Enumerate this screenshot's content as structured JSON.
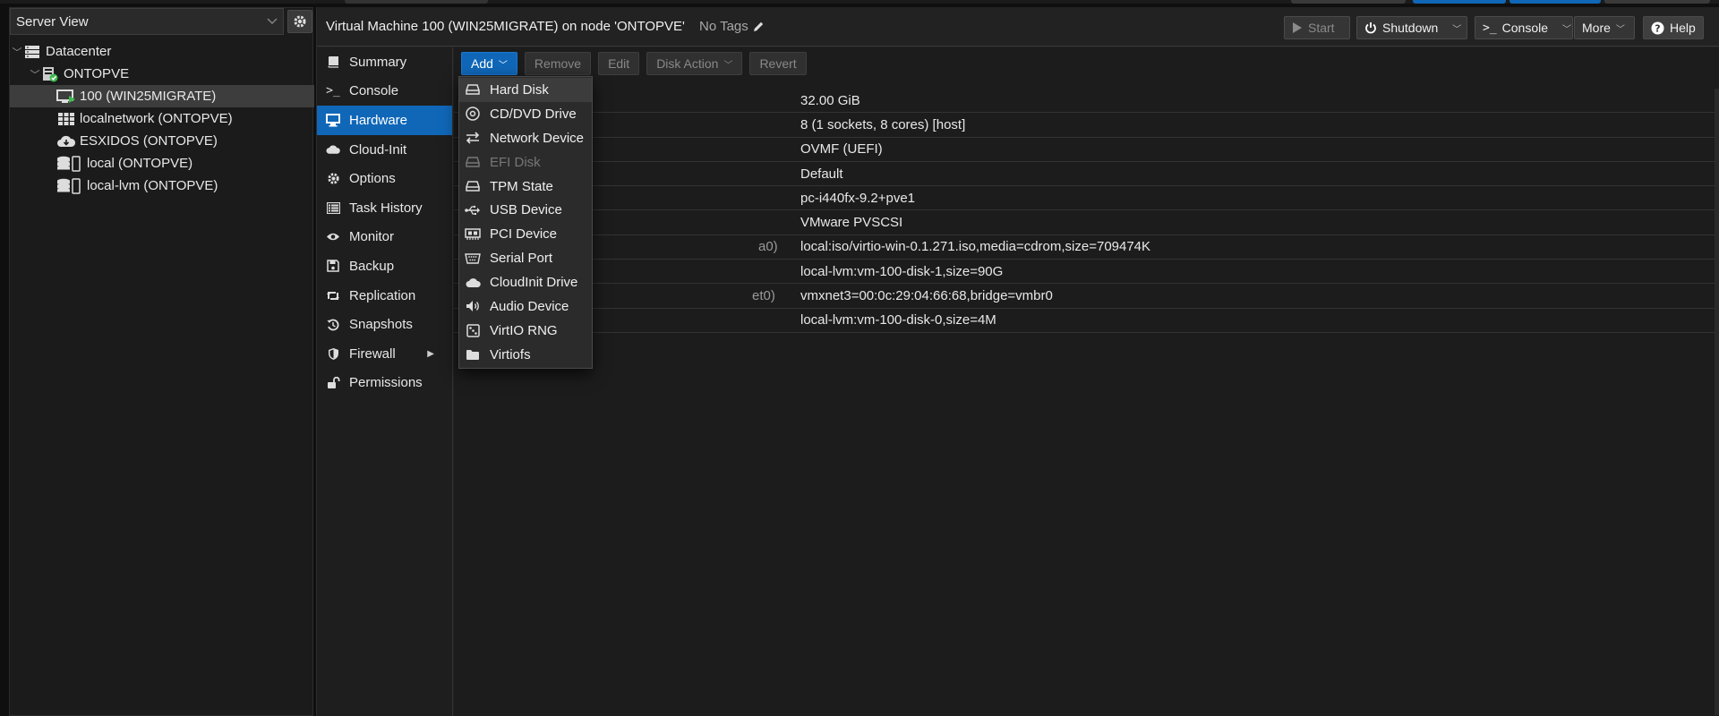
{
  "tree_panel": {
    "view_selector": "Server View",
    "nodes": [
      {
        "label": "Datacenter"
      },
      {
        "label": "ONTOPVE"
      },
      {
        "label": "100 (WIN25MIGRATE)"
      },
      {
        "label": "localnetwork (ONTOPVE)"
      },
      {
        "label": "ESXIDOS (ONTOPVE)"
      },
      {
        "label": "local (ONTOPVE)"
      },
      {
        "label": "local-lvm (ONTOPVE)"
      }
    ]
  },
  "header": {
    "title": "Virtual Machine 100 (WIN25MIGRATE) on node 'ONTOPVE'",
    "tags": "No Tags",
    "buttons": {
      "start": "Start",
      "shutdown": "Shutdown",
      "console": "Console",
      "more": "More",
      "help": "Help"
    }
  },
  "nav": {
    "items": [
      {
        "label": "Summary"
      },
      {
        "label": "Console"
      },
      {
        "label": "Hardware"
      },
      {
        "label": "Cloud-Init"
      },
      {
        "label": "Options"
      },
      {
        "label": "Task History"
      },
      {
        "label": "Monitor"
      },
      {
        "label": "Backup"
      },
      {
        "label": "Replication"
      },
      {
        "label": "Snapshots"
      },
      {
        "label": "Firewall"
      },
      {
        "label": "Permissions"
      }
    ]
  },
  "toolbar": {
    "add": "Add",
    "remove": "Remove",
    "edit": "Edit",
    "disk_action": "Disk Action",
    "revert": "Revert"
  },
  "hardware": {
    "rows": [
      {
        "key": "",
        "value": "32.00 GiB"
      },
      {
        "key": "",
        "value": "8 (1 sockets, 8 cores) [host]"
      },
      {
        "key": "",
        "value": "OVMF (UEFI)"
      },
      {
        "key": "",
        "value": "Default"
      },
      {
        "key": "",
        "value": "pc-i440fx-9.2+pve1"
      },
      {
        "key": "",
        "value": "VMware PVSCSI"
      },
      {
        "key": "a0)",
        "value": "local:iso/virtio-win-0.1.271.iso,media=cdrom,size=709474K"
      },
      {
        "key": "",
        "value": "local-lvm:vm-100-disk-1,size=90G"
      },
      {
        "key": "et0)",
        "value": "vmxnet3=00:0c:29:04:66:68,bridge=vmbr0"
      },
      {
        "key": "",
        "value": "local-lvm:vm-100-disk-0,size=4M"
      }
    ]
  },
  "add_menu": {
    "items": [
      {
        "label": "Hard Disk",
        "icon": "hard-disk-icon"
      },
      {
        "label": "CD/DVD Drive",
        "icon": "cd-dvd-icon"
      },
      {
        "label": "Network Device",
        "icon": "network-icon"
      },
      {
        "label": "EFI Disk",
        "icon": "efi-disk-icon"
      },
      {
        "label": "TPM State",
        "icon": "tpm-icon"
      },
      {
        "label": "USB Device",
        "icon": "usb-icon"
      },
      {
        "label": "PCI Device",
        "icon": "pci-icon"
      },
      {
        "label": "Serial Port",
        "icon": "serial-icon"
      },
      {
        "label": "CloudInit Drive",
        "icon": "cloud-icon"
      },
      {
        "label": "Audio Device",
        "icon": "audio-icon"
      },
      {
        "label": "VirtIO RNG",
        "icon": "dice-icon"
      },
      {
        "label": "Virtiofs",
        "icon": "folder-icon"
      }
    ]
  },
  "colors": {
    "accent": "#1067b8",
    "status_ok": "#3fb950"
  }
}
